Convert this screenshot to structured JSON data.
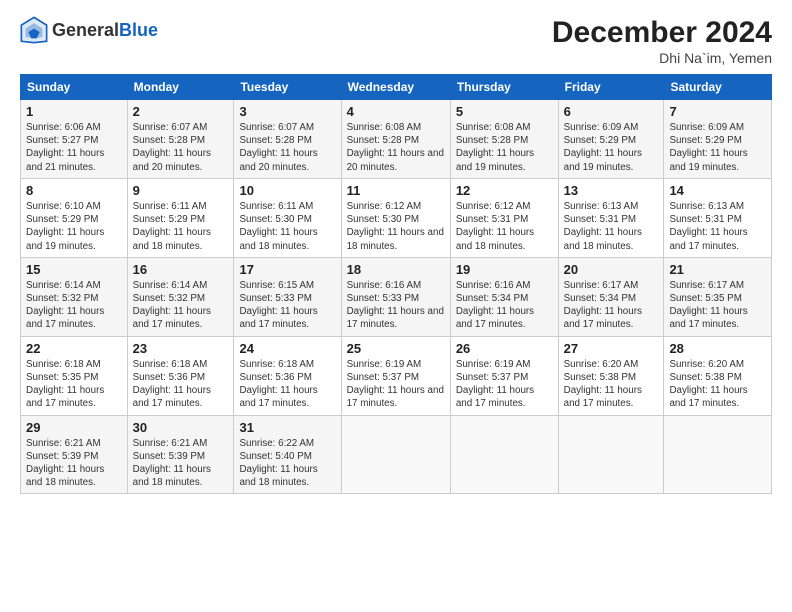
{
  "header": {
    "logo_general": "General",
    "logo_blue": "Blue",
    "month_year": "December 2024",
    "location": "Dhi Na`im, Yemen"
  },
  "weekdays": [
    "Sunday",
    "Monday",
    "Tuesday",
    "Wednesday",
    "Thursday",
    "Friday",
    "Saturday"
  ],
  "weeks": [
    [
      {
        "day": "1",
        "sunrise": "Sunrise: 6:06 AM",
        "sunset": "Sunset: 5:27 PM",
        "daylight": "Daylight: 11 hours and 21 minutes."
      },
      {
        "day": "2",
        "sunrise": "Sunrise: 6:07 AM",
        "sunset": "Sunset: 5:28 PM",
        "daylight": "Daylight: 11 hours and 20 minutes."
      },
      {
        "day": "3",
        "sunrise": "Sunrise: 6:07 AM",
        "sunset": "Sunset: 5:28 PM",
        "daylight": "Daylight: 11 hours and 20 minutes."
      },
      {
        "day": "4",
        "sunrise": "Sunrise: 6:08 AM",
        "sunset": "Sunset: 5:28 PM",
        "daylight": "Daylight: 11 hours and 20 minutes."
      },
      {
        "day": "5",
        "sunrise": "Sunrise: 6:08 AM",
        "sunset": "Sunset: 5:28 PM",
        "daylight": "Daylight: 11 hours and 19 minutes."
      },
      {
        "day": "6",
        "sunrise": "Sunrise: 6:09 AM",
        "sunset": "Sunset: 5:29 PM",
        "daylight": "Daylight: 11 hours and 19 minutes."
      },
      {
        "day": "7",
        "sunrise": "Sunrise: 6:09 AM",
        "sunset": "Sunset: 5:29 PM",
        "daylight": "Daylight: 11 hours and 19 minutes."
      }
    ],
    [
      {
        "day": "8",
        "sunrise": "Sunrise: 6:10 AM",
        "sunset": "Sunset: 5:29 PM",
        "daylight": "Daylight: 11 hours and 19 minutes."
      },
      {
        "day": "9",
        "sunrise": "Sunrise: 6:11 AM",
        "sunset": "Sunset: 5:29 PM",
        "daylight": "Daylight: 11 hours and 18 minutes."
      },
      {
        "day": "10",
        "sunrise": "Sunrise: 6:11 AM",
        "sunset": "Sunset: 5:30 PM",
        "daylight": "Daylight: 11 hours and 18 minutes."
      },
      {
        "day": "11",
        "sunrise": "Sunrise: 6:12 AM",
        "sunset": "Sunset: 5:30 PM",
        "daylight": "Daylight: 11 hours and 18 minutes."
      },
      {
        "day": "12",
        "sunrise": "Sunrise: 6:12 AM",
        "sunset": "Sunset: 5:31 PM",
        "daylight": "Daylight: 11 hours and 18 minutes."
      },
      {
        "day": "13",
        "sunrise": "Sunrise: 6:13 AM",
        "sunset": "Sunset: 5:31 PM",
        "daylight": "Daylight: 11 hours and 18 minutes."
      },
      {
        "day": "14",
        "sunrise": "Sunrise: 6:13 AM",
        "sunset": "Sunset: 5:31 PM",
        "daylight": "Daylight: 11 hours and 17 minutes."
      }
    ],
    [
      {
        "day": "15",
        "sunrise": "Sunrise: 6:14 AM",
        "sunset": "Sunset: 5:32 PM",
        "daylight": "Daylight: 11 hours and 17 minutes."
      },
      {
        "day": "16",
        "sunrise": "Sunrise: 6:14 AM",
        "sunset": "Sunset: 5:32 PM",
        "daylight": "Daylight: 11 hours and 17 minutes."
      },
      {
        "day": "17",
        "sunrise": "Sunrise: 6:15 AM",
        "sunset": "Sunset: 5:33 PM",
        "daylight": "Daylight: 11 hours and 17 minutes."
      },
      {
        "day": "18",
        "sunrise": "Sunrise: 6:16 AM",
        "sunset": "Sunset: 5:33 PM",
        "daylight": "Daylight: 11 hours and 17 minutes."
      },
      {
        "day": "19",
        "sunrise": "Sunrise: 6:16 AM",
        "sunset": "Sunset: 5:34 PM",
        "daylight": "Daylight: 11 hours and 17 minutes."
      },
      {
        "day": "20",
        "sunrise": "Sunrise: 6:17 AM",
        "sunset": "Sunset: 5:34 PM",
        "daylight": "Daylight: 11 hours and 17 minutes."
      },
      {
        "day": "21",
        "sunrise": "Sunrise: 6:17 AM",
        "sunset": "Sunset: 5:35 PM",
        "daylight": "Daylight: 11 hours and 17 minutes."
      }
    ],
    [
      {
        "day": "22",
        "sunrise": "Sunrise: 6:18 AM",
        "sunset": "Sunset: 5:35 PM",
        "daylight": "Daylight: 11 hours and 17 minutes."
      },
      {
        "day": "23",
        "sunrise": "Sunrise: 6:18 AM",
        "sunset": "Sunset: 5:36 PM",
        "daylight": "Daylight: 11 hours and 17 minutes."
      },
      {
        "day": "24",
        "sunrise": "Sunrise: 6:18 AM",
        "sunset": "Sunset: 5:36 PM",
        "daylight": "Daylight: 11 hours and 17 minutes."
      },
      {
        "day": "25",
        "sunrise": "Sunrise: 6:19 AM",
        "sunset": "Sunset: 5:37 PM",
        "daylight": "Daylight: 11 hours and 17 minutes."
      },
      {
        "day": "26",
        "sunrise": "Sunrise: 6:19 AM",
        "sunset": "Sunset: 5:37 PM",
        "daylight": "Daylight: 11 hours and 17 minutes."
      },
      {
        "day": "27",
        "sunrise": "Sunrise: 6:20 AM",
        "sunset": "Sunset: 5:38 PM",
        "daylight": "Daylight: 11 hours and 17 minutes."
      },
      {
        "day": "28",
        "sunrise": "Sunrise: 6:20 AM",
        "sunset": "Sunset: 5:38 PM",
        "daylight": "Daylight: 11 hours and 17 minutes."
      }
    ],
    [
      {
        "day": "29",
        "sunrise": "Sunrise: 6:21 AM",
        "sunset": "Sunset: 5:39 PM",
        "daylight": "Daylight: 11 hours and 18 minutes."
      },
      {
        "day": "30",
        "sunrise": "Sunrise: 6:21 AM",
        "sunset": "Sunset: 5:39 PM",
        "daylight": "Daylight: 11 hours and 18 minutes."
      },
      {
        "day": "31",
        "sunrise": "Sunrise: 6:22 AM",
        "sunset": "Sunset: 5:40 PM",
        "daylight": "Daylight: 11 hours and 18 minutes."
      },
      null,
      null,
      null,
      null
    ]
  ]
}
